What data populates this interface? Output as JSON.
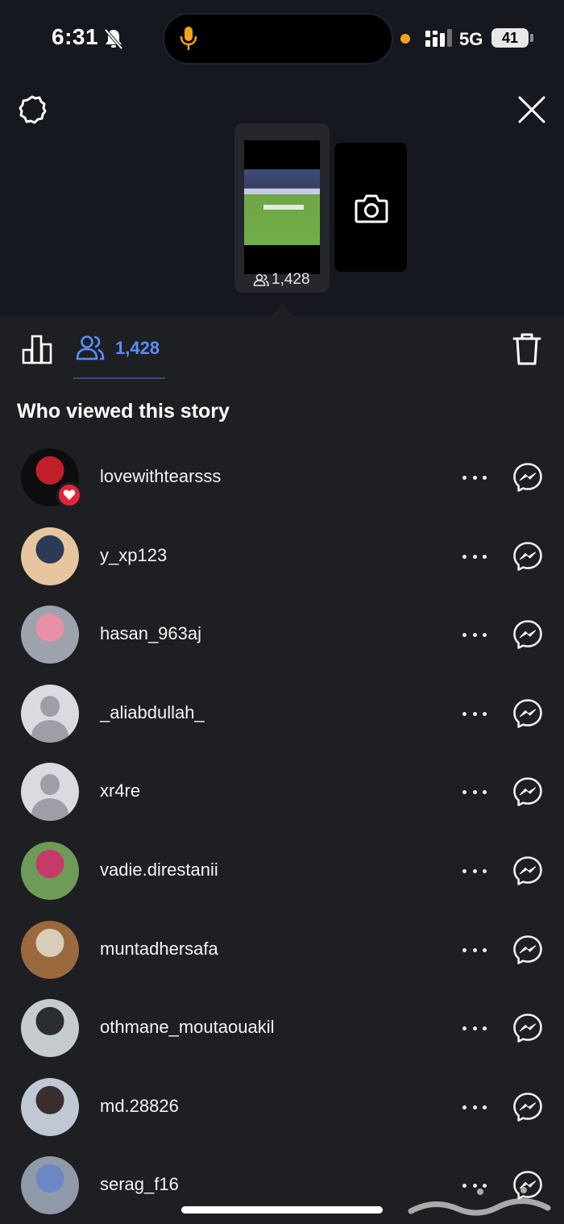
{
  "status_bar": {
    "time": "6:31",
    "network": "5G",
    "battery": "41"
  },
  "story": {
    "viewer_count": "1,428"
  },
  "tabs": {
    "viewers_count": "1,428"
  },
  "section_title": "Who viewed this story",
  "viewers": [
    {
      "username": "lovewithtearsss",
      "avatar": "photo",
      "liked": true,
      "c1": "#0d0d0d",
      "c2": "#c02028"
    },
    {
      "username": "y_xp123",
      "avatar": "photo",
      "liked": false,
      "c1": "#e6c59f",
      "c2": "#2b3a55"
    },
    {
      "username": "hasan_963aj",
      "avatar": "photo",
      "liked": false,
      "c1": "#9ca3ad",
      "c2": "#e890a6"
    },
    {
      "username": "_aliabdullah_",
      "avatar": "default",
      "liked": false
    },
    {
      "username": "xr4re",
      "avatar": "default",
      "liked": false
    },
    {
      "username": "vadie.direstanii",
      "avatar": "photo",
      "liked": false,
      "c1": "#6f9b58",
      "c2": "#c43a68"
    },
    {
      "username": "muntadhersafa",
      "avatar": "photo",
      "liked": false,
      "c1": "#9a6a3e",
      "c2": "#d8cdb8"
    },
    {
      "username": "othmane_moutaouakil",
      "avatar": "photo",
      "liked": false,
      "c1": "#c6cbcf",
      "c2": "#2c2d33"
    },
    {
      "username": "md.28826",
      "avatar": "photo",
      "liked": false,
      "c1": "#bfc8d3",
      "c2": "#3a2e2e"
    },
    {
      "username": "serag_f16",
      "avatar": "photo",
      "liked": false,
      "c1": "#8f9aa8",
      "c2": "#6d86c4"
    }
  ],
  "colors": {
    "accent": "#5b8cff",
    "background": "#1e1f23",
    "heart": "#e0263b"
  },
  "icons": {
    "settings": "gear-icon",
    "close": "close-icon",
    "camera": "camera-icon",
    "insights": "bar-chart-icon",
    "viewers": "people-icon",
    "delete": "trash-icon",
    "more": "more-horizontal-icon",
    "message": "messenger-icon"
  }
}
